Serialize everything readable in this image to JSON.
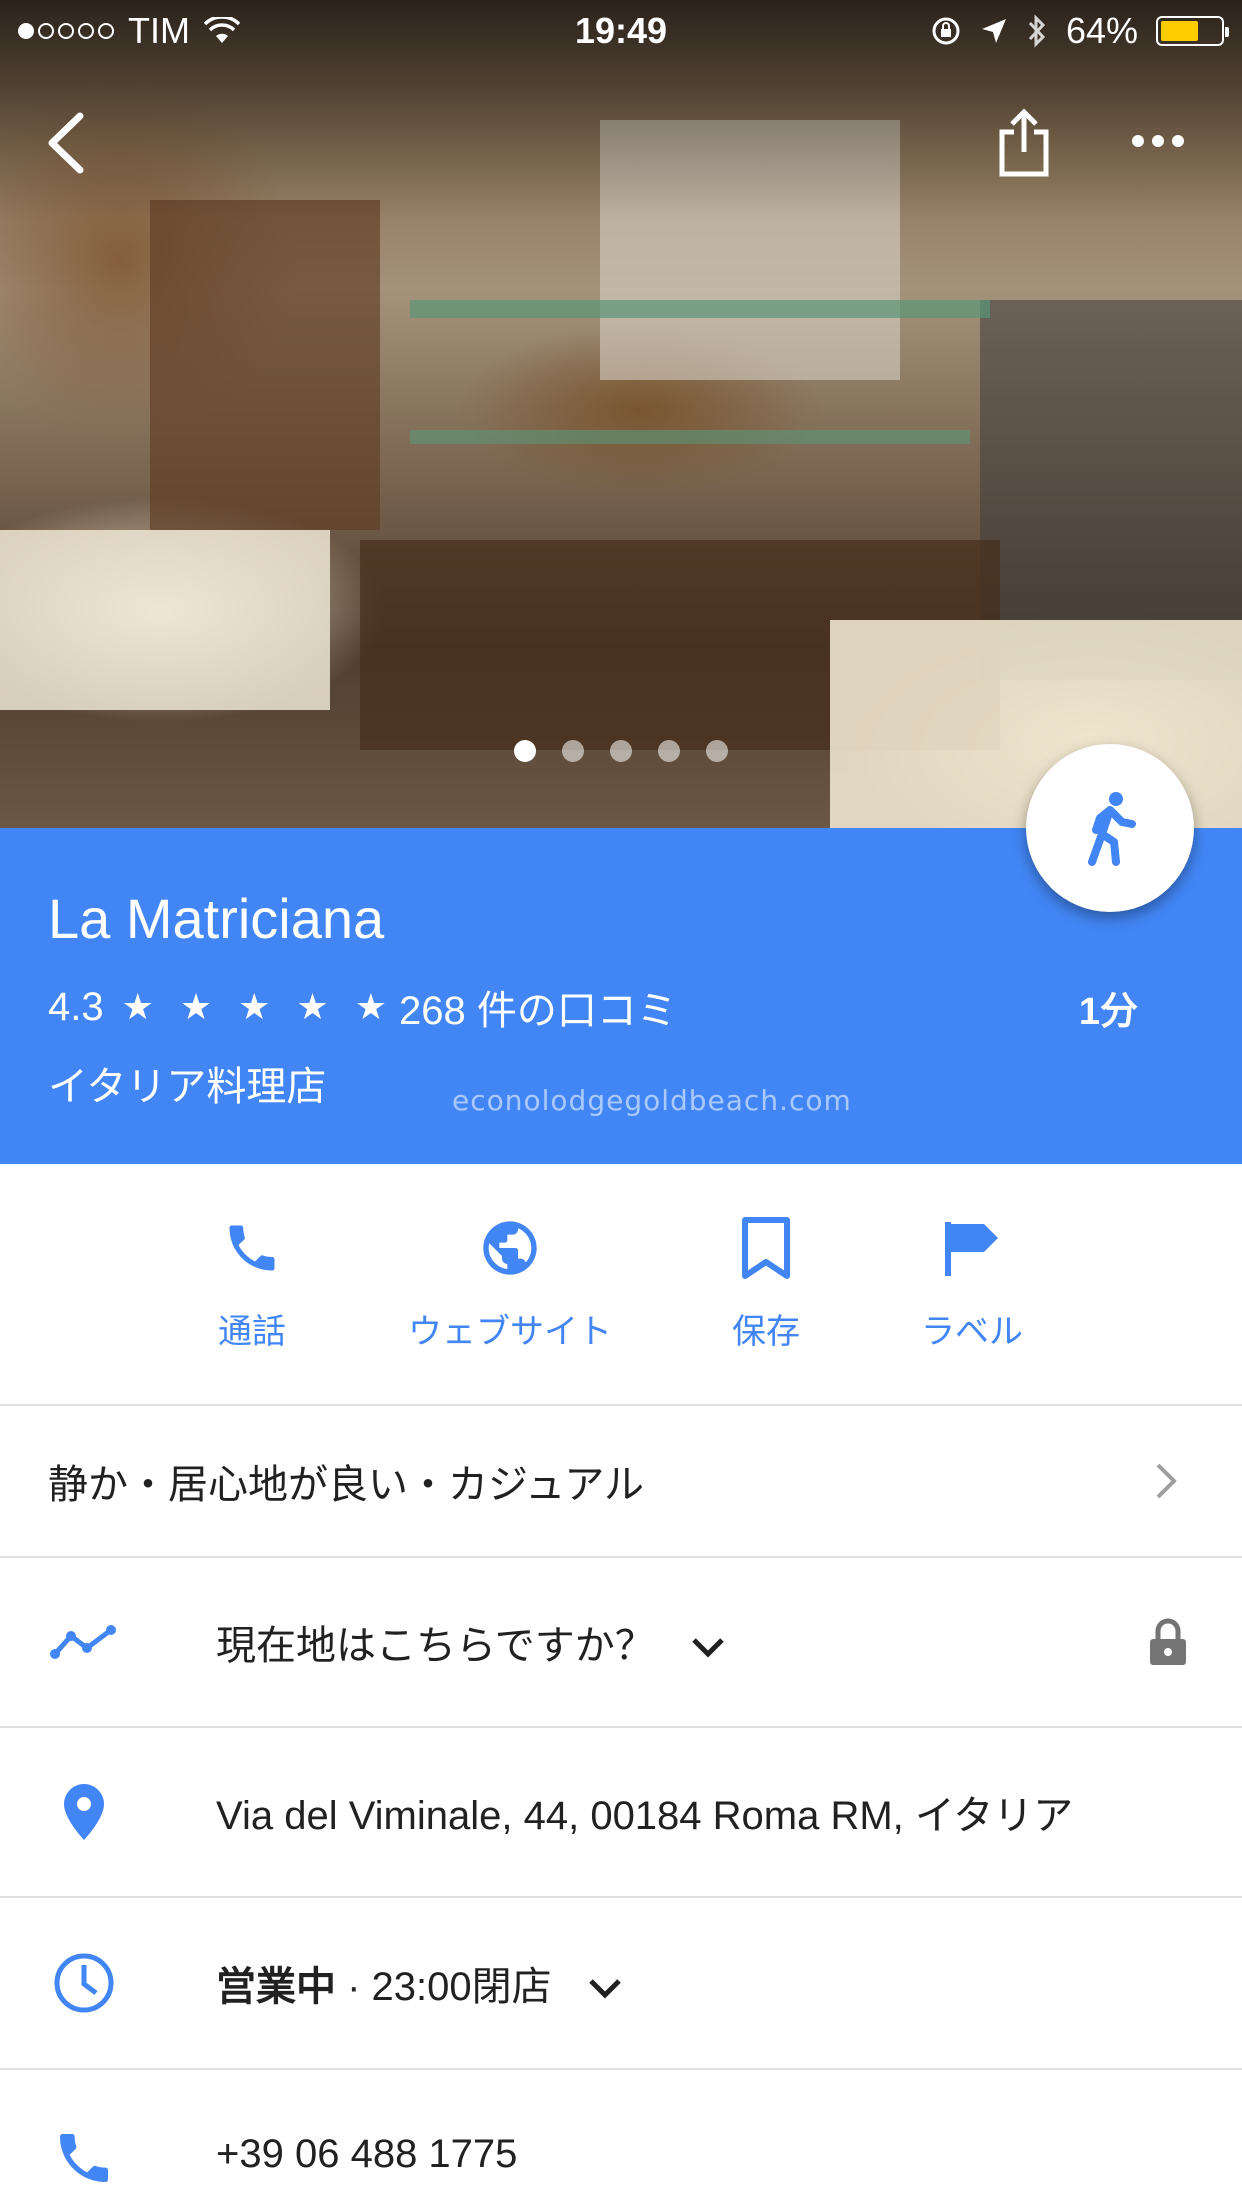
{
  "status_bar": {
    "carrier": "TIM",
    "time": "19:49",
    "battery": "64%",
    "battery_level": 0.64
  },
  "hero": {
    "photo_count": 5,
    "active_photo": 1
  },
  "place": {
    "name": "La Matriciana",
    "rating": "4.3",
    "stars": "★ ★ ★ ★ ★",
    "reviews": "268 件の口コミ",
    "type": "イタリア料理店",
    "walk_time": "1分",
    "watermark": "econolodgegoldbeach.com"
  },
  "actions": [
    {
      "label": "通話",
      "icon": "phone-icon"
    },
    {
      "label": "ウェブサイト",
      "icon": "globe-icon"
    },
    {
      "label": "保存",
      "icon": "bookmark-icon"
    },
    {
      "label": "ラベル",
      "icon": "flag-icon"
    }
  ],
  "details": {
    "atmosphere": "静か・居心地が良い・カジュアル",
    "location_prompt": "現在地はこちらですか？",
    "address": "Via del Viminale, 44, 00184 Roma RM, イタリア",
    "hours_status": "営業中",
    "hours_detail": " · 23:00閉店",
    "phone": "+39 06 488 1775"
  },
  "colors": {
    "header_blue": "#4286f5",
    "accent_blue": "#4285f4",
    "battery_yellow": "#ffcc00"
  }
}
